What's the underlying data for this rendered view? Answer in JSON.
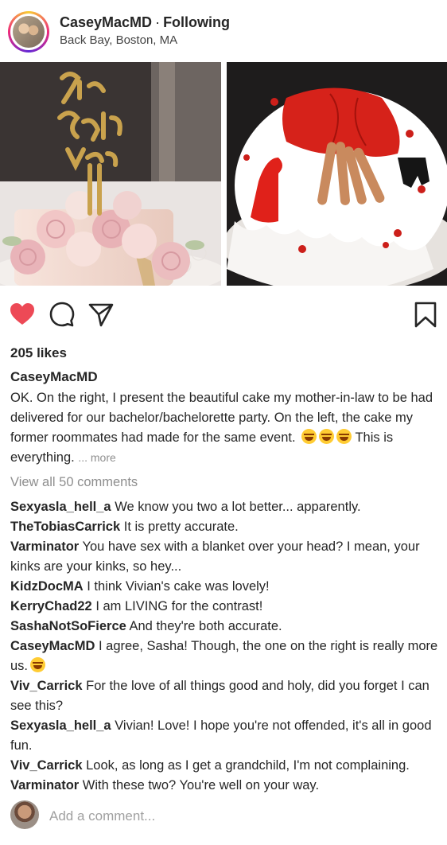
{
  "post": {
    "username": "CaseyMacMD",
    "separator": "·",
    "follow_status": "Following",
    "location": "Back Bay, Boston, MA"
  },
  "photos": {
    "left_topper_text": "She Said Yes"
  },
  "actions": {
    "like_icon": "heart-filled-icon",
    "comment_icon": "comment-icon",
    "share_icon": "send-icon",
    "save_icon": "bookmark-icon",
    "like_color": "#ed4956"
  },
  "likes": "205 likes",
  "caption": {
    "username": "CaseyMacMD",
    "text": "OK. On the right, I present the beautiful cake my mother-in-law to be had delivered for our bachelor/bachelorette party. On the left, the cake my former roommates had made for the same event.",
    "emoji": "laughing-emoji",
    "text2": "This is everything.",
    "more": "... more"
  },
  "view_all": "View all 50 comments",
  "comments": [
    {
      "user": "Sexyasla_hell_a",
      "text": "We know you two a lot better... apparently."
    },
    {
      "user": "TheTobiasCarrick",
      "text": "It is pretty accurate."
    },
    {
      "user": "Varminator",
      "text": "You have sex with a blanket over your head? I mean, your kinks are your kinks, so hey..."
    },
    {
      "user": "KidzDocMA",
      "text": "I think Vivian's cake was lovely!"
    },
    {
      "user": "KerryChad22",
      "text": "I am LIVING for the contrast!"
    },
    {
      "user": "SashaNotSoFierce",
      "text": "And they're both accurate."
    },
    {
      "user": "CaseyMacMD",
      "text": "I agree, Sasha! Though, the one on the right is really more us."
    },
    {
      "user": "Viv_Carrick",
      "text": "For the love of all things good and holy, did you forget I can see this?"
    },
    {
      "user": "Sexyasla_hell_a",
      "text": "Vivian! Love! I hope you're not offended, it's all in good fun."
    },
    {
      "user": "Viv_Carrick",
      "text": "Look, as long as I get a grandchild, I'm not complaining."
    },
    {
      "user": "Varminator",
      "text": "With these two? You're well on your way."
    }
  ],
  "add_comment": {
    "placeholder": "Add a comment..."
  }
}
